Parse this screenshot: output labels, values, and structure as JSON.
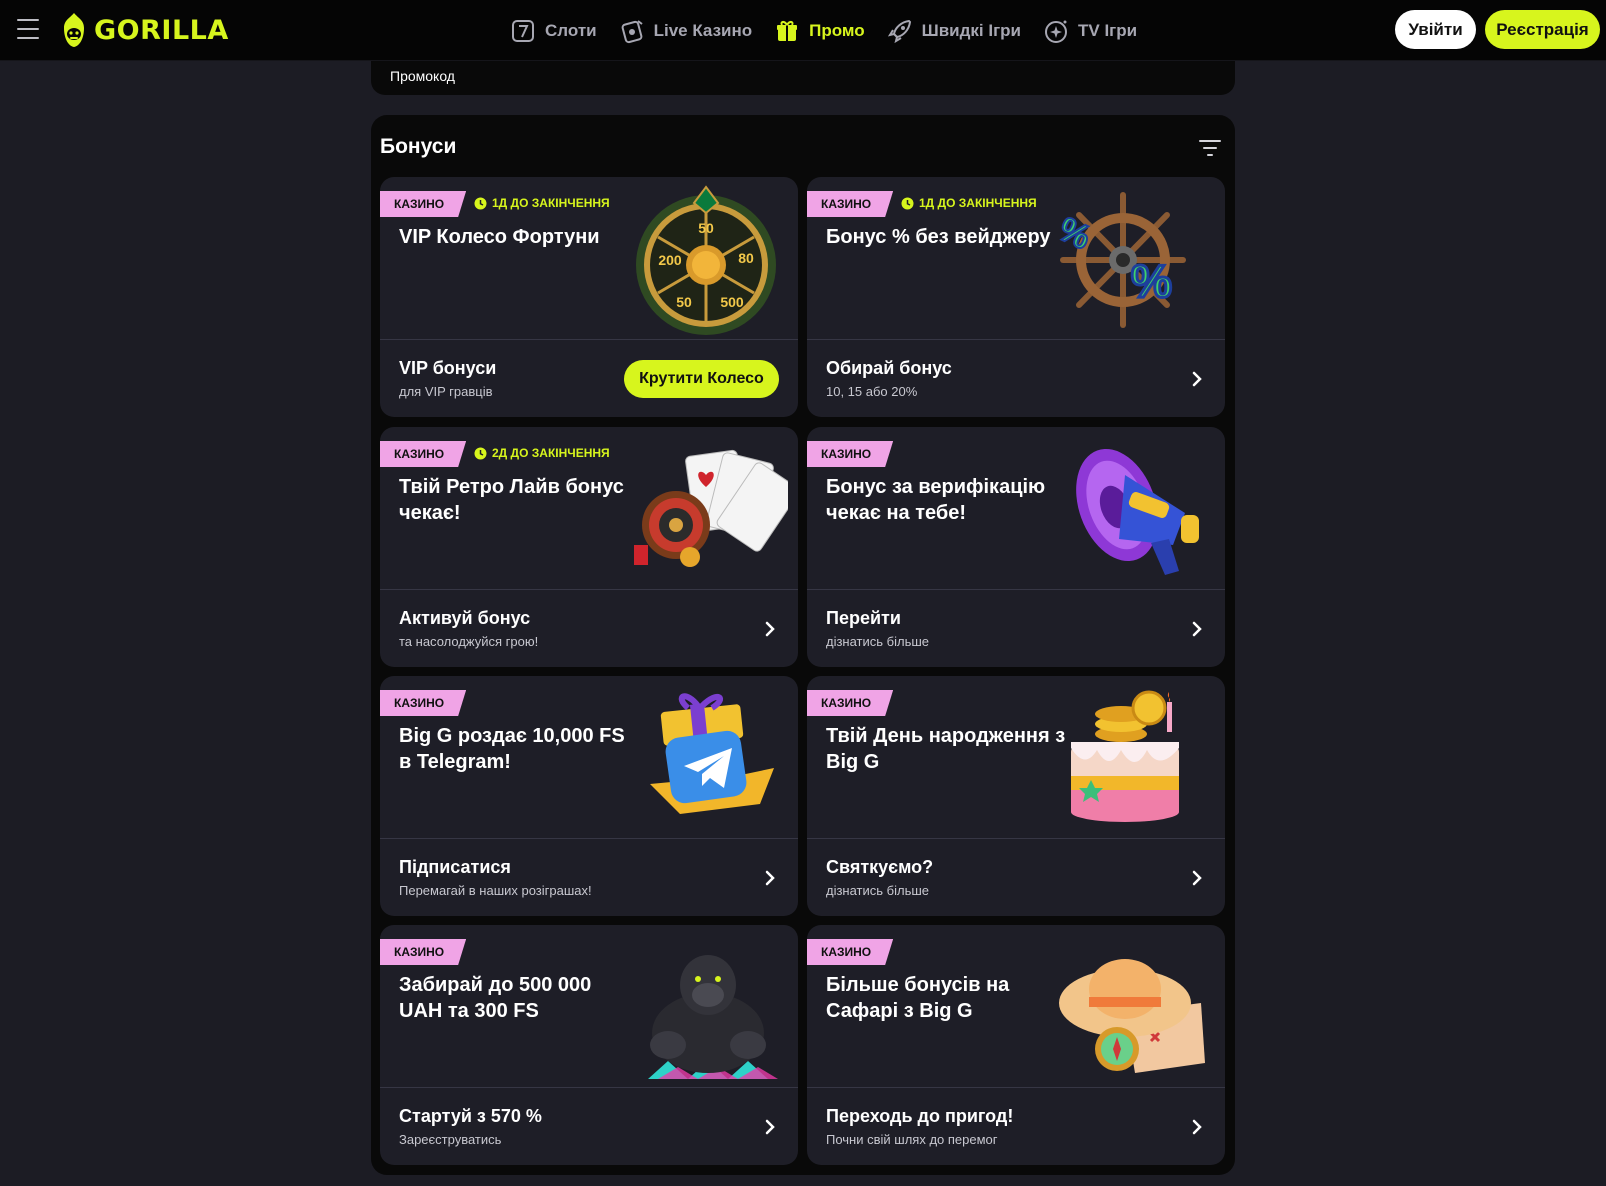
{
  "header": {
    "logo_text": "GORILLA",
    "nav": [
      {
        "label": "Слоти",
        "icon": "slot-seven-icon"
      },
      {
        "label": "Live Казино",
        "icon": "live-chip-icon"
      },
      {
        "label": "Промо",
        "icon": "gift-icon"
      },
      {
        "label": "Швидкі Ігри",
        "icon": "rocket-icon"
      },
      {
        "label": "TV Ігри",
        "icon": "tv-star-icon"
      }
    ],
    "login_label": "Увійти",
    "register_label": "Реєстрація"
  },
  "promo_strip": {
    "label": "Промокод"
  },
  "bonuses": {
    "title": "Бонуси",
    "cards": [
      {
        "badge": "КАЗИНО",
        "timer": "1Д ДО ЗАКІНЧЕННЯ",
        "title": "VIP Колесо Фортуни",
        "sub_title": "VIP бонуси",
        "sub_text": "для VIP гравців",
        "action_label": "Крутити Колесо",
        "art": "fortune-wheel-icon"
      },
      {
        "badge": "КАЗИНО",
        "timer": "1Д ДО ЗАКІНЧЕННЯ",
        "title": "Бонус % без вейджеру",
        "sub_title": "Обирай бонус",
        "sub_text": "10, 15 або 20%",
        "art": "ship-wheel-percent-icon"
      },
      {
        "badge": "КАЗИНО",
        "timer": "2Д ДО ЗАКІНЧЕННЯ",
        "title": "Твій Ретро Лайв бонус чекає!",
        "sub_title": "Активуй бонус",
        "sub_text": "та насолоджуйся грою!",
        "art": "roulette-cards-icon"
      },
      {
        "badge": "КАЗИНО",
        "title": "Бонус за верифікацію чекає на тебе!",
        "sub_title": "Перейти",
        "sub_text": "дізнатись більше",
        "art": "megaphone-icon"
      },
      {
        "badge": "КАЗИНО",
        "title": "Big G роздає 10,000 FS в Telegram!",
        "sub_title": "Підписатися",
        "sub_text": "Перемагай в наших розіграшах!",
        "art": "telegram-gift-icon"
      },
      {
        "badge": "КАЗИНО",
        "title": "Твій День народження з Big G",
        "sub_title": "Святкуємо?",
        "sub_text": "дізнатись більше",
        "art": "birthday-cake-icon"
      },
      {
        "badge": "КАЗИНО",
        "title": "Забирай до 500 000 UAH та 300 FS",
        "sub_title": "Стартуй з 570 %",
        "sub_text": "Зареєструватись",
        "art": "gorilla-mascot-icon"
      },
      {
        "badge": "КАЗИНО",
        "title": "Більше бонусів на Сафарі з Big G",
        "sub_title": "Переходь до пригод!",
        "sub_text": "Почни свій шлях до перемог",
        "art": "safari-hat-map-icon"
      }
    ]
  },
  "colors": {
    "accent": "#d7f51d",
    "badge": "#f0a4e6",
    "card": "#1e1e27",
    "panel": "#090909",
    "background": "#1c1c24"
  },
  "wheel_labels": [
    "50",
    "80",
    "500",
    "50",
    "200"
  ]
}
